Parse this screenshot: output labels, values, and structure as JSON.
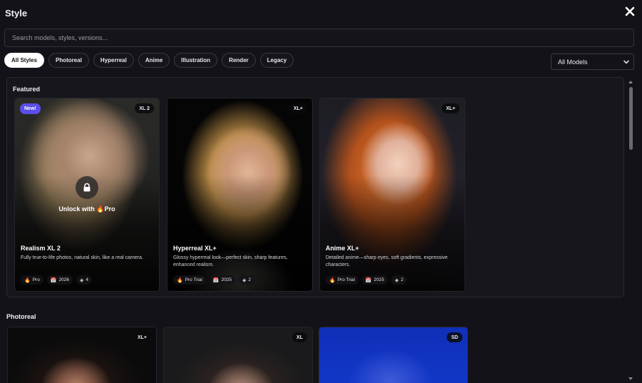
{
  "header": {
    "title": "Style"
  },
  "search": {
    "placeholder": "Search models, styles, versions..."
  },
  "filters": [
    "All Styles",
    "Photoreal",
    "Hyperreal",
    "Anime",
    "Illustration",
    "Render",
    "Legacy"
  ],
  "model_select": {
    "value": "All Models"
  },
  "featured": {
    "title": "Featured",
    "cards": [
      {
        "name": "Realism XL 2",
        "desc": "Fully true-to-life photos, natural skin, like a real camera.",
        "version": "XL 2",
        "new": "New!",
        "locked": true,
        "unlock_label": "Unlock with",
        "unlock_tier": "Pro",
        "tier": "Pro",
        "year": "2026",
        "count": "4"
      },
      {
        "name": "Hyperreal XL+",
        "desc": "Glossy hyperreal look—perfect skin, sharp features, enhanced realism.",
        "version": "XL+",
        "tier": "Pro Trial",
        "year": "2025",
        "count": "2"
      },
      {
        "name": "Anime XL+",
        "desc": "Detailed anime—sharp eyes, soft gradients, expressive characters.",
        "version": "XL+",
        "tier": "Pro Trial",
        "year": "2025",
        "count": "2"
      }
    ]
  },
  "photoreal": {
    "title": "Photoreal",
    "cards": [
      {
        "version": "XL+"
      },
      {
        "version": "XL"
      },
      {
        "version": "SD"
      }
    ]
  },
  "colors": {
    "accent_new": "#5b4fe6",
    "fire": "#ff7a1a"
  }
}
